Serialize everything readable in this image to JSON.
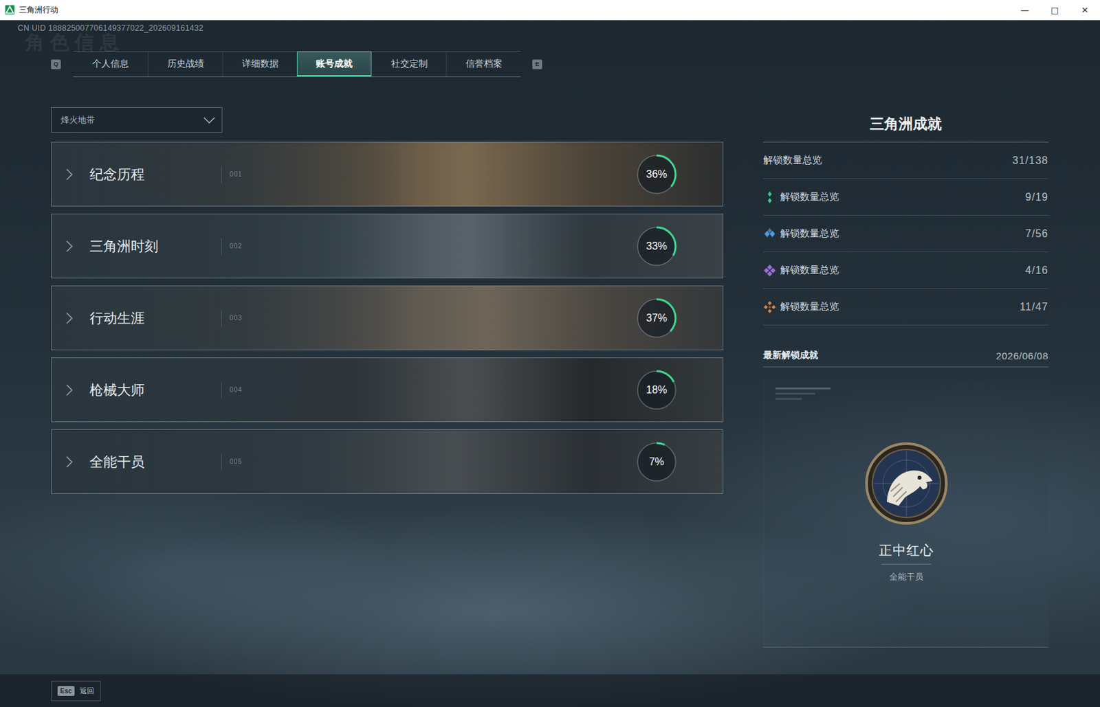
{
  "window": {
    "title": "三角洲行动",
    "controls": [
      "—",
      "□",
      "✕"
    ]
  },
  "uid": "CN UID 188825007706149377022_202609161432",
  "watermark": "角色信息",
  "tab_keys": {
    "prev": "Q",
    "next": "E"
  },
  "tabs": [
    {
      "label": "个人信息",
      "selected": false
    },
    {
      "label": "历史战绩",
      "selected": false
    },
    {
      "label": "详细数据",
      "selected": false
    },
    {
      "label": "账号成就",
      "selected": true
    },
    {
      "label": "社交定制",
      "selected": false
    },
    {
      "label": "信誉档案",
      "selected": false
    }
  ],
  "mode_dropdown": {
    "value": "烽火地带",
    "expanded": false
  },
  "categories": [
    {
      "title": "纪念历程",
      "index": "001",
      "percent": "36%",
      "level": 0.36,
      "expanded": false
    },
    {
      "title": "三角洲时刻",
      "index": "002",
      "percent": "33%",
      "level": 0.33,
      "expanded": false
    },
    {
      "title": "行动生涯",
      "index": "003",
      "percent": "37%",
      "level": 0.37,
      "expanded": false
    },
    {
      "title": "枪械大师",
      "index": "004",
      "percent": "18%",
      "level": 0.18,
      "expanded": false
    },
    {
      "title": "全能干员",
      "index": "005",
      "percent": "7%",
      "level": 0.07,
      "expanded": false
    }
  ],
  "panel": {
    "title": "三角洲成就",
    "summary": {
      "label": "解锁数量总览",
      "count": "31/138"
    },
    "tiers": [
      {
        "label": "解锁数量总览",
        "count": "9/19",
        "color": "#2fd08a"
      },
      {
        "label": "解锁数量总览",
        "count": "7/56",
        "color": "#4a9ee8"
      },
      {
        "label": "解锁数量总览",
        "count": "4/16",
        "color": "#9b6fe0"
      },
      {
        "label": "解锁数量总览",
        "count": "11/47",
        "color": "#e8843a"
      }
    ],
    "latest": {
      "label": "最新解锁成就",
      "date": "2026/06/08",
      "name": "正中红心",
      "category": "全能干员"
    }
  },
  "footer": {
    "key": "Esc",
    "label": "返回"
  }
}
